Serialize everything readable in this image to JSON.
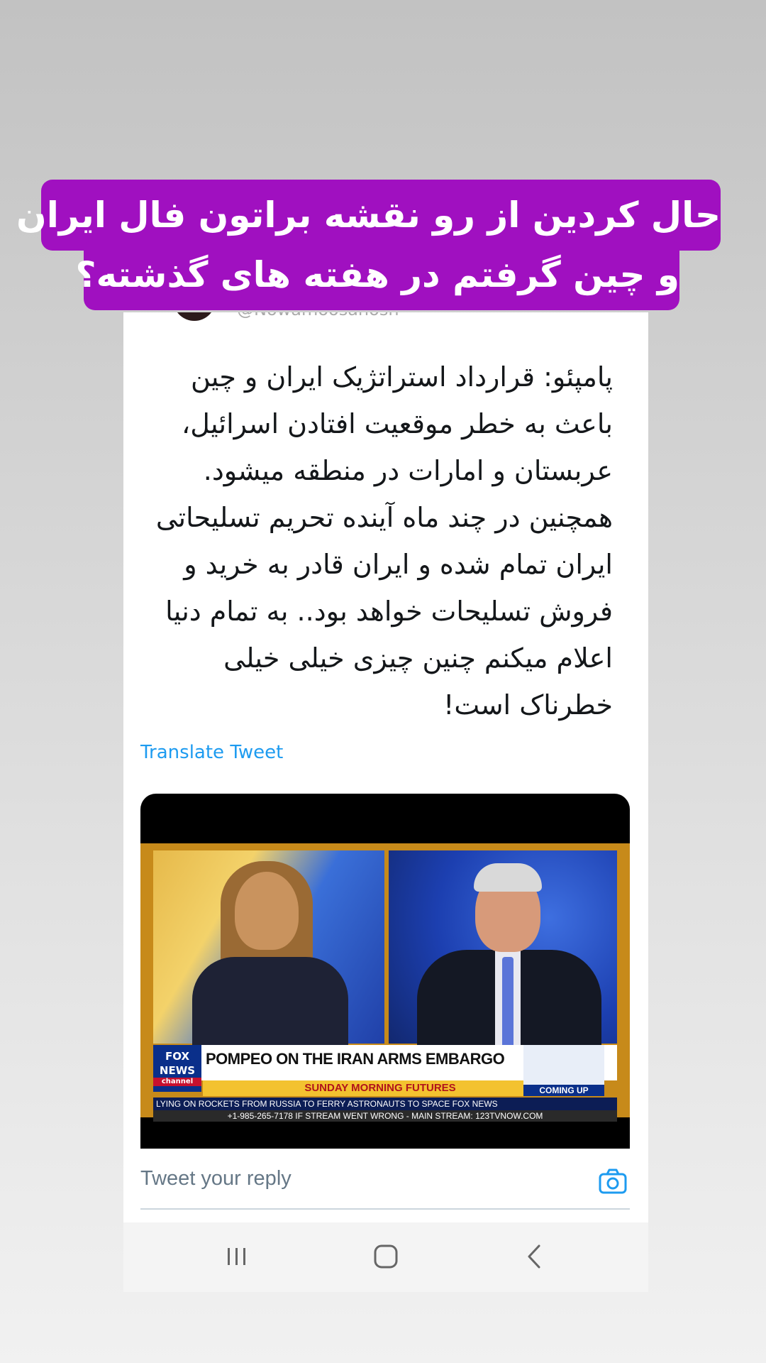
{
  "story_caption": {
    "line1": "حال کردین از رو نقشه براتون فال ایران",
    "line2": "و چین گرفتم در هفته های گذشته؟"
  },
  "tweet": {
    "handle_partial": "@Nowamoosanosn",
    "text": "پامپئو: قرارداد استراتژیک ایران و چین\nباعث به خطر موقعیت افتادن اسرائیل،\nعربستان و امارات در منطقه میشود.\nهمچنین در چند ماه آینده تحریم تسلیحاتی\nایران تمام شده و ایران قادر به خرید و\nفروش تسلیحات خواهد بود.. به تمام دنیا\nاعلام میکنم چنین چیزی خیلی خیلی\nخطرناک است!",
    "translate_label": "Translate Tweet"
  },
  "video": {
    "logo_line1": "FOX",
    "logo_line2": "NEWS",
    "logo_line3": "channel",
    "headline": "POMPEO ON THE IRAN ARMS EMBARGO",
    "show_name": "SUNDAY MORNING FUTURES",
    "coming_up": "COMING UP",
    "ticker": "LYING ON ROCKETS FROM RUSSIA TO FERRY ASTRONAUTS TO SPACE   FOX NEWS",
    "stream_line": "+1-985-265-7178 IF STREAM WENT WRONG - MAIN STREAM: 123TVNOW.COM"
  },
  "reply": {
    "placeholder": "Tweet your reply",
    "camera_icon": "camera-icon"
  },
  "navbar": {
    "recents_icon": "recent-apps-icon",
    "home_icon": "home-icon",
    "back_icon": "back-icon"
  },
  "colors": {
    "caption_bg": "#a010c0",
    "link": "#1d9bf0",
    "text": "#14171a"
  }
}
